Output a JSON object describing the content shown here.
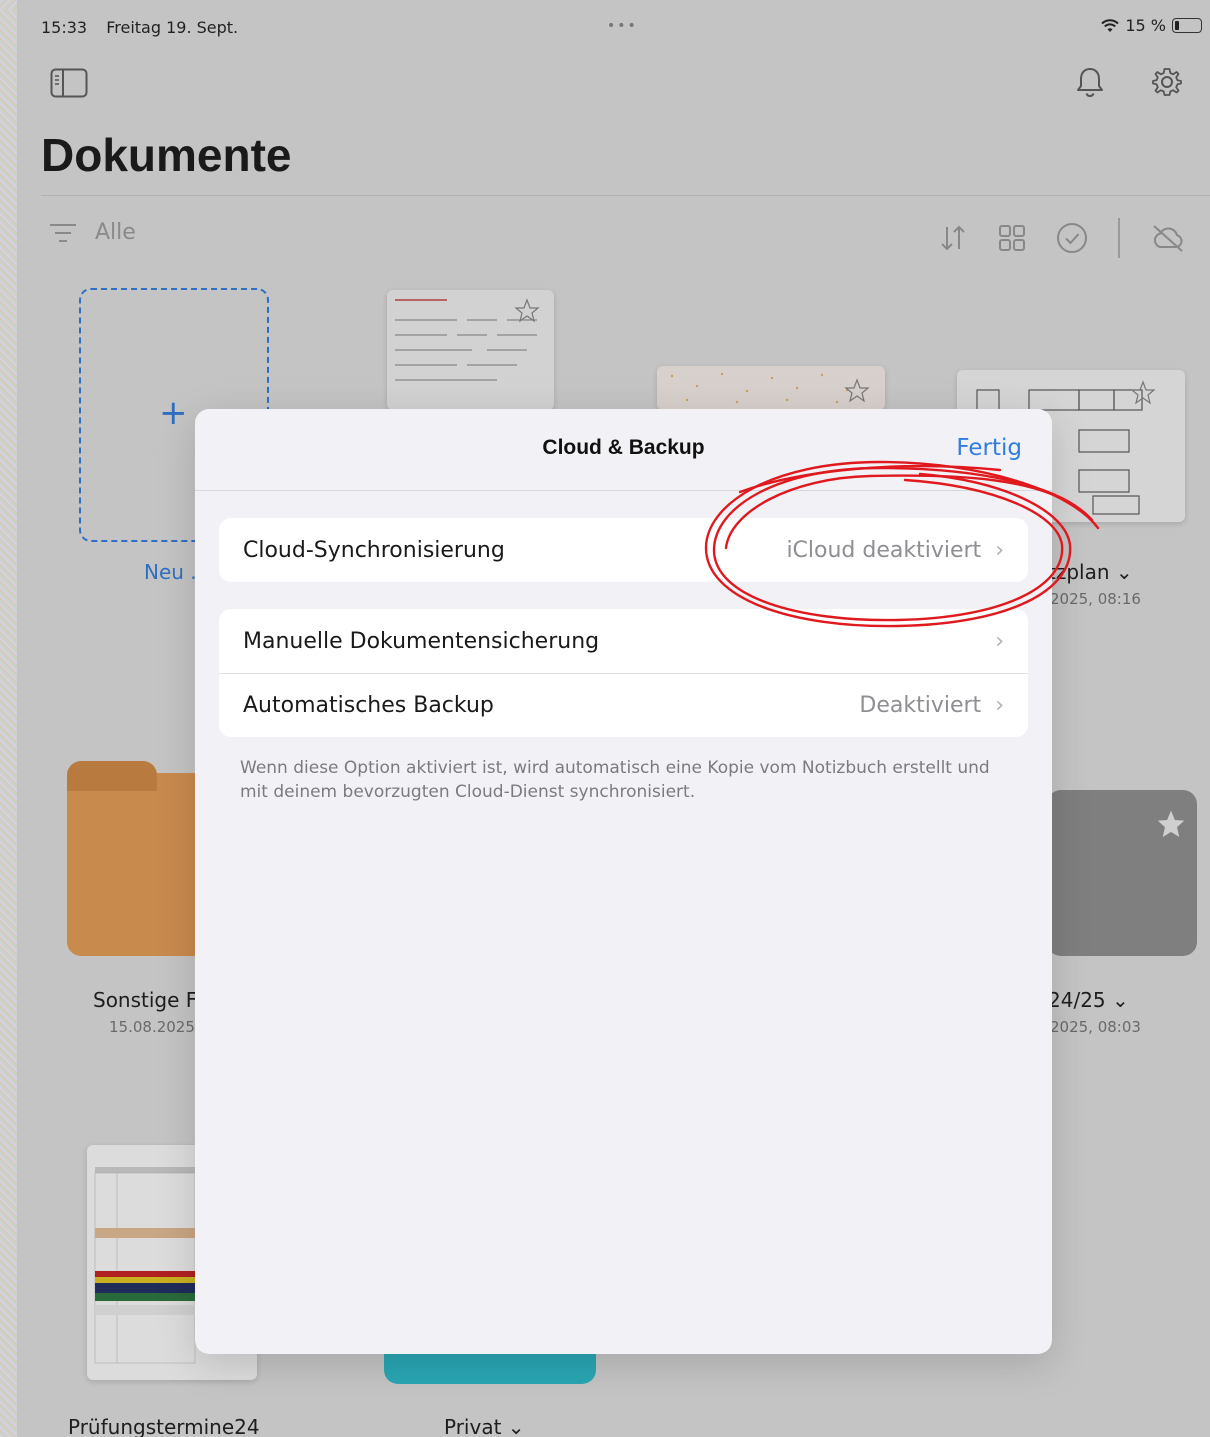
{
  "status_bar": {
    "time": "15:33",
    "date": "Freitag 19. Sept.",
    "center_dots": "•••",
    "battery": "15 %"
  },
  "header": {
    "title": "Dokumente",
    "filter_label": "Alle"
  },
  "grid": {
    "new_label": "Neu .",
    "items": [
      {
        "label": "tzplan ⌄",
        "sub": "2025, 08:16"
      },
      {
        "label": "Sonstige F",
        "sub": "15.08.2025,"
      },
      {
        "label": "24/25 ⌄",
        "sub": "2025, 08:03"
      },
      {
        "label": "Prüfungstermine24",
        "sub": ""
      },
      {
        "label": "Privat ⌄",
        "sub": ""
      }
    ],
    "folder_colors": {
      "orange": "#c98a4e",
      "gray": "#7f7f7f",
      "teal": "#2aa6b4"
    }
  },
  "modal": {
    "title": "Cloud & Backup",
    "done": "Fertig",
    "rows": [
      {
        "label": "Cloud-Synchronisierung",
        "value": "iCloud deaktiviert"
      },
      {
        "label": "Manuelle Dokumentensicherung",
        "value": ""
      },
      {
        "label": "Automatisches Backup",
        "value": "Deaktiviert"
      }
    ],
    "footnote": "Wenn diese Option aktiviert ist, wird automatisch eine Kopie vom Notizbuch erstellt und mit deinem bevorzugten Cloud-Dienst synchronisiert."
  },
  "colors": {
    "accent": "#2f7de1",
    "annotation": "#e0191e"
  }
}
